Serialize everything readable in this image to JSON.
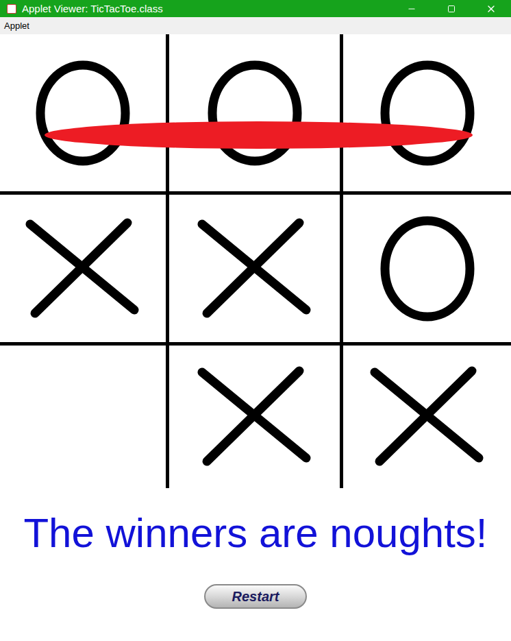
{
  "window": {
    "title": "Applet Viewer: TicTacToe.class"
  },
  "menu": [
    {
      "label": "Applet"
    }
  ],
  "board": {
    "cells": [
      {
        "kind": "nought"
      },
      {
        "kind": "nought"
      },
      {
        "kind": "nought"
      },
      {
        "kind": "cross"
      },
      {
        "kind": "cross"
      },
      {
        "kind": "nought"
      },
      {
        "kind": "empty"
      },
      {
        "kind": "cross"
      },
      {
        "kind": "cross"
      }
    ],
    "win_line": {
      "row": 0
    }
  },
  "message": "The winners are noughts!",
  "buttons": [
    {
      "label": "Restart"
    }
  ]
}
